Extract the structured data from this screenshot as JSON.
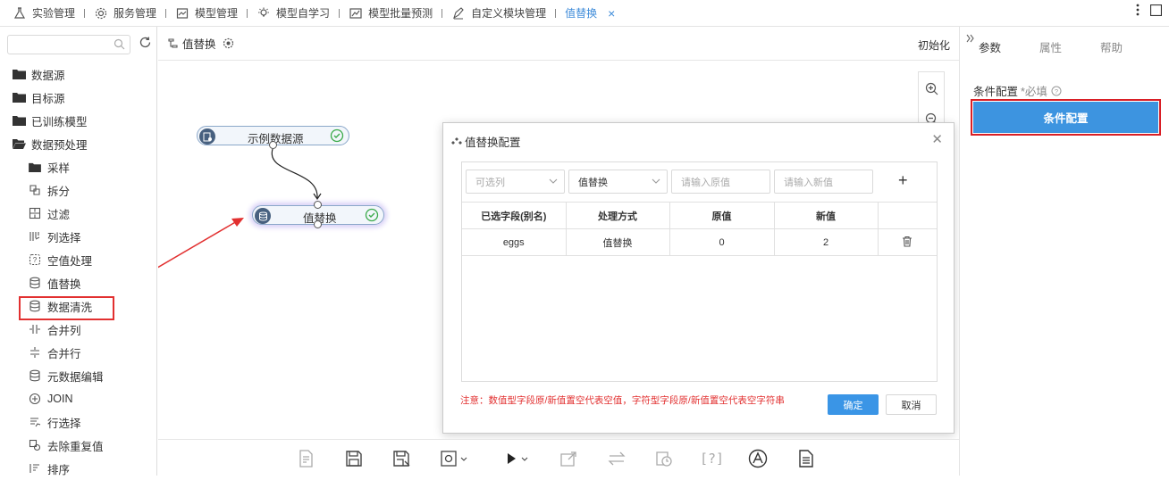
{
  "top_tabs": [
    {
      "label": "实验管理",
      "icon": "flask-icon"
    },
    {
      "label": "服务管理",
      "icon": "gear-service-icon"
    },
    {
      "label": "模型管理",
      "icon": "model-icon"
    },
    {
      "label": "模型自学习",
      "icon": "bulb-icon"
    },
    {
      "label": "模型批量预测",
      "icon": "trend-chart-icon"
    },
    {
      "label": "自定义模块管理",
      "icon": "custom-module-icon"
    },
    {
      "label": "值替换",
      "icon": "",
      "active": true
    }
  ],
  "sidebar": {
    "search_placeholder": "",
    "folders": [
      {
        "label": "数据源"
      },
      {
        "label": "目标源"
      },
      {
        "label": "已训练模型"
      },
      {
        "label": "数据预处理"
      }
    ],
    "items": [
      {
        "label": "采样"
      },
      {
        "label": "拆分"
      },
      {
        "label": "过滤"
      },
      {
        "label": "列选择"
      },
      {
        "label": "空值处理"
      },
      {
        "label": "值替换"
      },
      {
        "label": "数据清洗"
      },
      {
        "label": "合并列"
      },
      {
        "label": "合并行"
      },
      {
        "label": "元数据编辑"
      },
      {
        "label": "JOIN"
      },
      {
        "label": "行选择"
      },
      {
        "label": "去除重复值"
      },
      {
        "label": "排序"
      }
    ]
  },
  "canvas": {
    "title": "值替换",
    "init_label": "初始化",
    "nodes": [
      {
        "label": "示例数据源"
      },
      {
        "label": "值替换"
      }
    ]
  },
  "dialog": {
    "title": "值替换配置",
    "column_select_placeholder": "可选列",
    "method_value": "值替换",
    "old_value_placeholder": "请输入原值",
    "new_value_placeholder": "请输入新值",
    "add_label": "+",
    "headers": [
      "已选字段(别名)",
      "处理方式",
      "原值",
      "新值",
      ""
    ],
    "rows": [
      {
        "field": "eggs",
        "method": "值替换",
        "old": "0",
        "new": "2"
      }
    ],
    "note": "注意：数值型字段原/新值置空代表空值，字符型字段原/新值置空代表空字符串",
    "ok_label": "确定",
    "cancel_label": "取消"
  },
  "right_panel": {
    "tabs": [
      "参数",
      "属性",
      "帮助"
    ],
    "active_tab": "参数",
    "condition_label": "条件配置",
    "required_label": "*必填",
    "button_label": "条件配置"
  },
  "colors": {
    "accent": "#3d8bd9",
    "primary_button": "#3d94e0",
    "highlight_red": "#e23030",
    "node_icon_bg": "#47607f",
    "success_green": "#3aaa4a"
  }
}
